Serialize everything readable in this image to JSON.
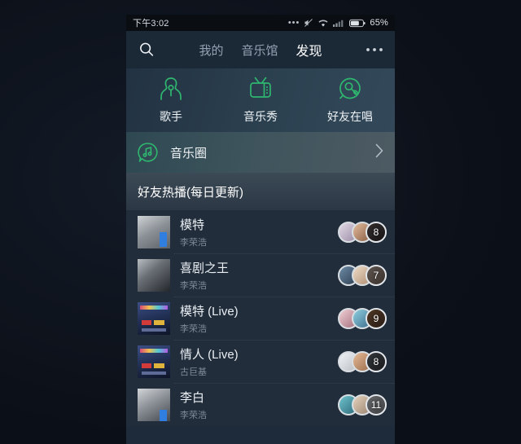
{
  "statusbar": {
    "time": "下午3:02",
    "more_dots": "•••",
    "battery_percent": "65%",
    "icons": [
      "mute-icon",
      "wifi-icon",
      "signal-icon",
      "battery-icon"
    ]
  },
  "header": {
    "search_icon": "search-icon",
    "more_icon": "more-options-icon",
    "tabs": [
      {
        "label": "我的",
        "active": false
      },
      {
        "label": "音乐馆",
        "active": false
      },
      {
        "label": "发现",
        "active": true
      }
    ]
  },
  "entries": [
    {
      "label": "歌手",
      "icon": "singer-icon"
    },
    {
      "label": "音乐秀",
      "icon": "tv-music-show-icon"
    },
    {
      "label": "好友在唱",
      "icon": "friends-singing-icon"
    }
  ],
  "music_circle": {
    "label": "音乐圈",
    "icon": "music-note-bubble-icon",
    "chevron": "›"
  },
  "section": {
    "title": "好友热播(每日更新)"
  },
  "songs": [
    {
      "title": "模特",
      "artist": "李荣浩",
      "count": "8",
      "cover": [
        "#cfd3d6",
        "#5c6168"
      ],
      "avatars": [
        "#b9a3b6",
        "#caa083",
        "#2d2a2c"
      ]
    },
    {
      "title": "喜剧之王",
      "artist": "李荣浩",
      "count": "7",
      "cover": [
        "#9aa0a6",
        "#2b2f34"
      ],
      "avatars": [
        "#4b6a86",
        "#d8c3b0",
        "#7b6a63"
      ]
    },
    {
      "title": "模特 (Live)",
      "artist": "李荣浩",
      "count": "9",
      "cover": [
        "#2a3a63",
        "#121a31"
      ],
      "avatars": [
        "#c9a6b4",
        "#6fa5c2",
        "#5a3f2e"
      ]
    },
    {
      "title": "情人 (Live)",
      "artist": "古巨基",
      "count": "8",
      "cover": [
        "#2a3a63",
        "#121a31"
      ],
      "avatars": [
        "#d9dcdf",
        "#c8a184",
        "#2f3a42"
      ]
    },
    {
      "title": "李白",
      "artist": "李荣浩",
      "count": "11",
      "cover": [
        "#c9ccd0",
        "#4a4f55"
      ],
      "avatars": [
        "#4f9aa8",
        "#cdb8a4",
        "#8d949a"
      ]
    }
  ],
  "colors": {
    "accent_green": "#2fb66f",
    "header_bg": "#1b2836",
    "list_bg": "#222d3b",
    "text_primary": "#e9eef3",
    "text_secondary": "#7e8b99"
  }
}
